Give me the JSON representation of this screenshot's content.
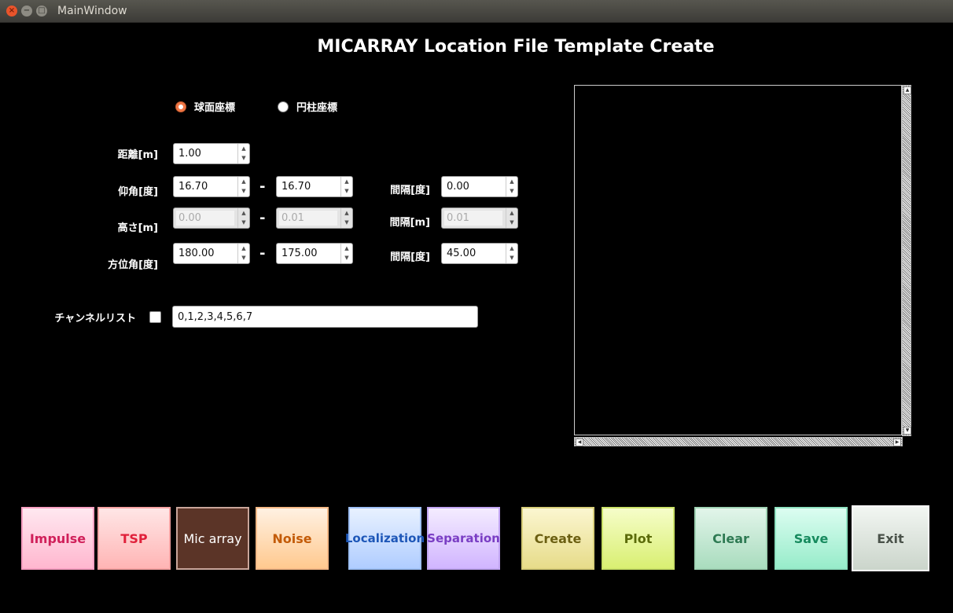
{
  "window": {
    "title": "MainWindow"
  },
  "header": {
    "title": "MICARRAY Location File Template Create"
  },
  "coord": {
    "spherical": "球面座標",
    "cylindrical": "円柱座標",
    "selected": "spherical"
  },
  "labels": {
    "distance": "距離[m]",
    "elevation": "仰角[度]",
    "height": "高さ[m]",
    "azimuth": "方位角[度]",
    "interval_deg": "間隔[度]",
    "interval_m": "間隔[m]",
    "dash": "-",
    "channel_list": "チャンネルリスト"
  },
  "values": {
    "distance": "1.00",
    "elevation_from": "16.70",
    "elevation_to": "16.70",
    "elevation_interval": "0.00",
    "height_from": "0.00",
    "height_to": "0.01",
    "height_interval": "0.01",
    "azimuth_from": "180.00",
    "azimuth_to": "175.00",
    "azimuth_interval": "45.00",
    "channel_list": "0,1,2,3,4,5,6,7"
  },
  "buttons": {
    "impulse": "Impulse",
    "tsp": "TSP",
    "mic_array": "Mic array",
    "noise": "Noise",
    "localization": "Localization",
    "separation": "Separation",
    "create": "Create",
    "plot": "Plot",
    "clear": "Clear",
    "save": "Save",
    "exit": "Exit"
  },
  "colors": {
    "impulse": "#ffc6d8",
    "tsp": "#ffc6c6",
    "mic_array": "#5b3427",
    "noise": "#ffd7b2",
    "localization": "#c6dcff",
    "separation": "#e2cdff",
    "create": "#efe7a6",
    "plot": "#e6f59a",
    "clear": "#bfe6cf",
    "save": "#b4f4dc",
    "exit": "#dfe6df"
  }
}
